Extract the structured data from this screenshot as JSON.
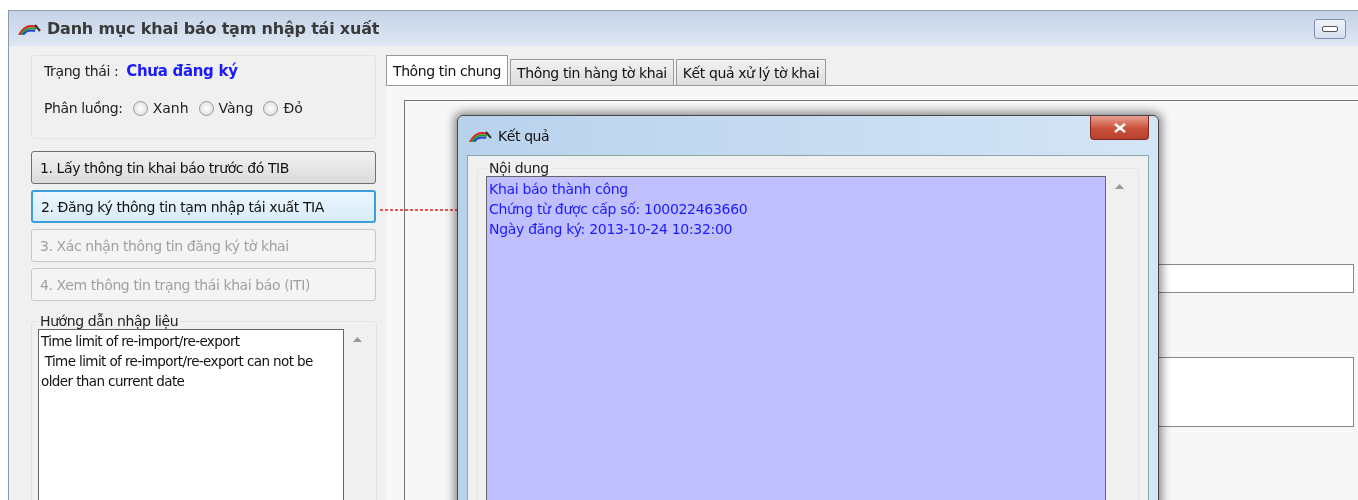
{
  "window": {
    "title": "Danh mục khai báo tạm nhập tái xuất"
  },
  "status": {
    "label": "Trạng thái :",
    "value": "Chưa đăng ký"
  },
  "lane": {
    "label": "Phân luồng:",
    "options": [
      {
        "label": "Xanh",
        "selected": false
      },
      {
        "label": "Vàng",
        "selected": false
      },
      {
        "label": "Đỏ",
        "selected": false
      }
    ]
  },
  "actions": [
    {
      "label": "1. Lấy thông tin khai báo trước đó TIB",
      "disabled": false,
      "focused": false
    },
    {
      "label": "2. Đăng ký thông tin tạm nhập tái xuất TIA",
      "disabled": false,
      "focused": true
    },
    {
      "label": "3. Xác nhận thông tin đăng ký tờ khai",
      "disabled": true,
      "focused": false
    },
    {
      "label": "4. Xem thông tin trạng thái khai báo (ITI)",
      "disabled": true,
      "focused": false
    }
  ],
  "guide": {
    "title": "Hướng dẫn nhập liệu",
    "lines": [
      "Time limit of re-import/re-export",
      " Time limit of re-import/re-export can not be older than current date"
    ]
  },
  "tabs": [
    {
      "label": "Thông tin chung",
      "selected": true
    },
    {
      "label": "Thông tin hàng tờ khai",
      "selected": false
    },
    {
      "label": "Kết quả xử lý tờ khai",
      "selected": false
    }
  ],
  "dialog": {
    "title": "Kết quả",
    "group": "Nội dung",
    "lines": [
      "Khai báo thành công",
      "Chứng từ được cấp số: 100022463660",
      "Ngày đăng ký: 2013-10-24 10:32:00"
    ]
  }
}
